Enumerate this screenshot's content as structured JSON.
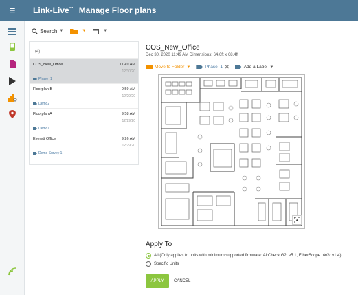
{
  "header": {
    "brand": "Link-Live",
    "brand_mark": "™",
    "title": "Manage Floor plans"
  },
  "toolbar": {
    "search_label": "Search",
    "search_icon": "search-icon",
    "folder_icon": "folder-icon",
    "calendar_icon": "calendar-icon"
  },
  "sidebar": {
    "icons": [
      "list-icon",
      "device-icon",
      "file-icon",
      "play-icon",
      "analytics-icon",
      "location-icon",
      "wifi-icon"
    ]
  },
  "list": {
    "count": "(4)",
    "items": [
      {
        "name": "COS_New_Office",
        "time": "11:49 AM",
        "date": "12/30/20",
        "tag": "Phase_1"
      },
      {
        "name": "Floorplan B",
        "time": "9:59 AM",
        "date": "12/29/20",
        "tag": "Demo2"
      },
      {
        "name": "Floorplan A",
        "time": "9:58 AM",
        "date": "12/29/20",
        "tag": "Demo1"
      },
      {
        "name": "Everett Office",
        "time": "9:26 AM",
        "date": "12/29/20",
        "tag": "Demo Survey 1"
      }
    ]
  },
  "detail": {
    "title": "COS_New_Office",
    "meta": "Dec 30, 2020 11:49 AM Dimensions: 64.6ft x 68.4ft",
    "move_to_folder": "Move to Folder",
    "label_current": "Phase_1",
    "add_label": "Add a Label"
  },
  "apply": {
    "title": "Apply To",
    "option_all": "All (Only applies to units with minimum supported firmware: AirCheck G2: v5.1, EtherScope nXG: v1.4)",
    "option_specific": "Specific Units",
    "apply_button": "APPLY",
    "cancel_button": "CANCEL"
  },
  "colors": {
    "header_bg": "#4d7896",
    "accent_green": "#8cc63f",
    "accent_orange": "#f39200",
    "label_blue": "#4a7aa3"
  }
}
